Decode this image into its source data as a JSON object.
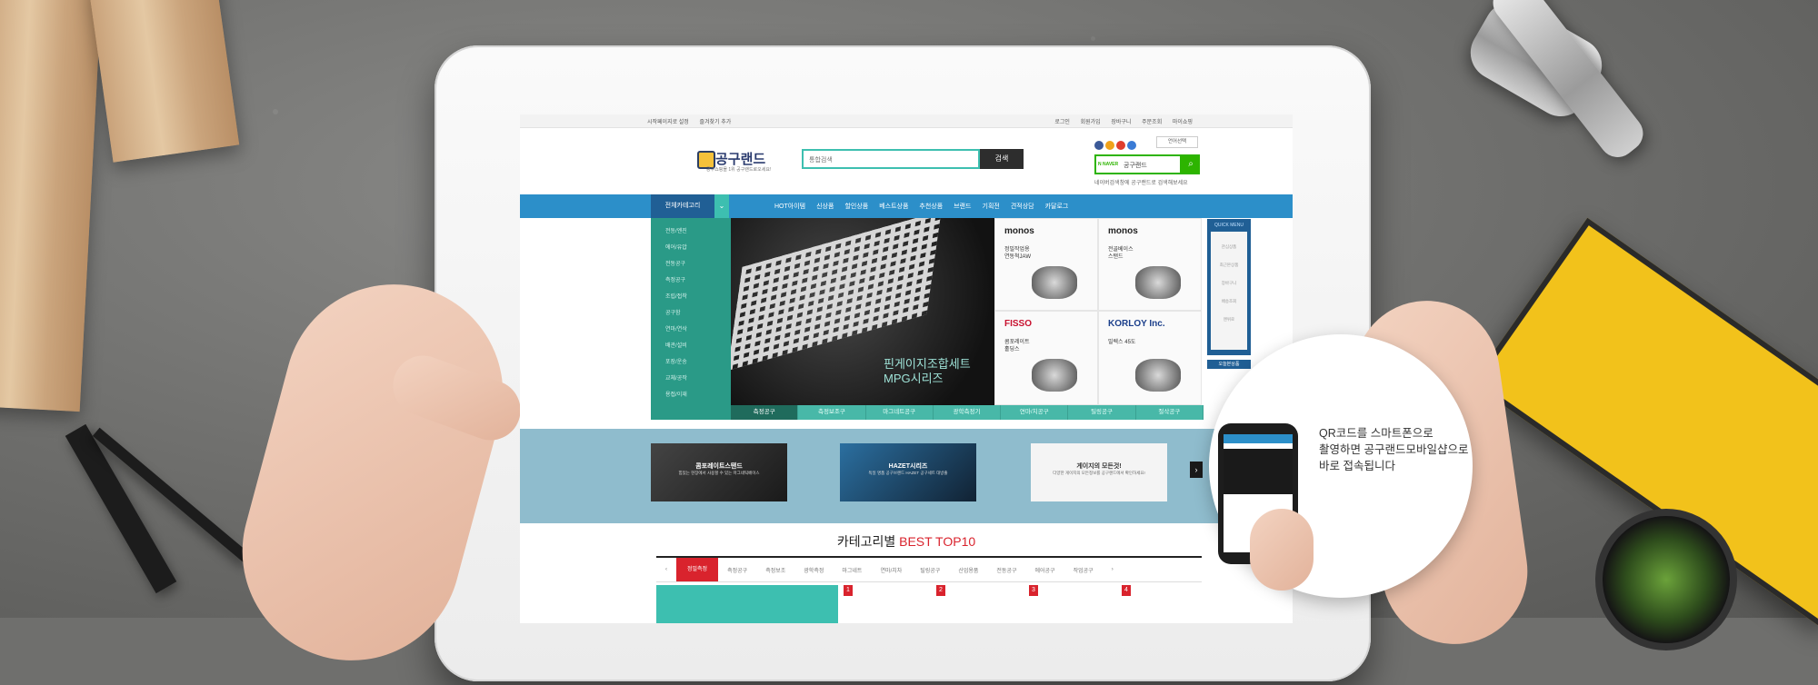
{
  "site": {
    "topbar": {
      "left": [
        "시작페이지로 설정",
        "즐겨찾기 추가"
      ],
      "right": [
        "로그인",
        "회원가입",
        "장바구니",
        "주문조회",
        "마이쇼핑"
      ]
    },
    "logo": {
      "name": "공구랜드",
      "tagline": "공구쇼핑몰 1위 공구랜드로오세요!"
    },
    "search": {
      "placeholder": "통합검색",
      "button": "검색"
    },
    "language": "언어선택",
    "naver": {
      "label": "N NAVER",
      "query": "공구랜드",
      "note": "네이버검색창에 공구랜드로 검색해보세요"
    },
    "nav": {
      "all_categories": "전체카테고리",
      "items": [
        "HOT아이템",
        "신상품",
        "할인상품",
        "베스트상품",
        "추천상품",
        "브랜드",
        "기획전",
        "견적상담",
        "카달로그"
      ]
    },
    "side_categories": [
      "전동/엔진",
      "에어/유압",
      "전동공구",
      "측정공구",
      "조립/접착",
      "공구함",
      "연마/연삭",
      "배관/설비",
      "포장/운송",
      "교체/공작",
      "용접/이재"
    ],
    "hero": {
      "line1": "핀게이지조합세트",
      "line2": "MPG시리즈"
    },
    "products": [
      {
        "brand": "monos",
        "name1": "정밀작업용",
        "name2": "연동척JAW"
      },
      {
        "brand": "monos",
        "name1": "전골베이스",
        "name2": "스탠드"
      },
      {
        "brand": "FISSO",
        "name1": "콤포레이트",
        "name2": "홀딩스"
      },
      {
        "brand": "KORLOY Inc.",
        "name1": "밀렉스 45도",
        "name2": ""
      }
    ],
    "hero_tabs": [
      "측정공구",
      "측정보조구",
      "마그네트공구",
      "광학측정기",
      "연마/치공구",
      "틸링공구",
      "절삭공구"
    ],
    "quick_menu": {
      "title": "QUICK MENU",
      "items": [
        "관심상품",
        "최근본상품",
        "장바구니",
        "배송조회",
        "맨위로"
      ],
      "bottom": "오늘본상품"
    },
    "banners": [
      {
        "title": "콤포레이트스탠드",
        "sub": "힘있는 현장에서 사용할 수 있는 마그네틱베이스"
      },
      {
        "title": "HAZET시리즈",
        "sub": "독일 명품 공구브랜드 HAZET 공구세트 대방출"
      },
      {
        "title": "게이지의 모든것!",
        "sub": "다양한 게이지의 모든정보를 공구랜드에서 확인하세요!"
      }
    ],
    "best": {
      "prefix": "카테고리별",
      "suffix": "BEST TOP10"
    },
    "category_tabs": [
      "정밀측정",
      "측정공구",
      "측정보조",
      "광학측정",
      "마그네트",
      "연마/치차",
      "틸링공구",
      "산업용품",
      "전동공구",
      "에어공구",
      "작업공구"
    ],
    "ranks": [
      "1",
      "2",
      "3",
      "4"
    ]
  },
  "qr": {
    "text": "QR코드를 스마트폰으로\n촬영하면 공구랜드모바일샵으로\n바로 접속됩니다"
  },
  "colors": {
    "teal": "#3dbfb0",
    "nav_blue": "#2c8fc9",
    "red": "#d9232d",
    "naver_green": "#2db400"
  }
}
